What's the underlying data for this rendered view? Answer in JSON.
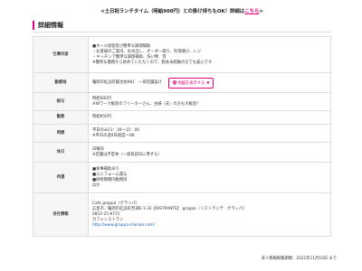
{
  "notice": {
    "prefix": "<土日祝ランチタイム（時給900円）との掛け持ちもOK！詳細は",
    "link": "こちら",
    "suffix": ">"
  },
  "section": {
    "title": "詳細情報"
  },
  "rows": {
    "job": {
      "label": "仕事内容",
      "lines": [
        "■ホール接客及び簡単な調理補助",
        "・お客様のご案内、お水出し、オーダー取り、料理運び、レジ",
        "・キッチンで簡単な調理補助、洗い物　等",
        "※簡単な業務から始めていただくので、飲食未経験の方でも安心です"
      ]
    },
    "location": {
      "label": "勤務地",
      "address": "亀岡市紅忌町鍛冶坊981　一部店舗設け",
      "map_button": "地図を表示する"
    },
    "wage": {
      "label": "給与",
      "lines": [
        "時給900円",
        "※Wワーク歓迎のフリーターさん、主婦（夫）の方も大歓迎！"
      ]
    },
    "transport": {
      "label": "勤務",
      "lines": [
        "時給850円"
      ]
    },
    "hours": {
      "label": "時間",
      "lines": [
        "平日のみ11：30〜15：00",
        "※平日の週4日程度〜OK"
      ]
    },
    "holiday": {
      "label": "休日",
      "lines": [
        "日曜日",
        "※店舗は不定休（一部祝前日に準ずる）"
      ]
    },
    "benefits": {
      "label": "待遇",
      "lines": [
        "■食事補助あり",
        "■ユニフォーム貸与",
        "■研修期間内勤務同",
        "ほか"
      ]
    },
    "company": {
      "label": "会社情報",
      "lines": [
        "Cafe grappa（グラッパ）",
        "広島市／亀岡市紅忌町西浦6-1-32【RISTRANTE】 grappa（リストランテ　グラッパ）",
        "0852-25-9715",
        "カフェレストラン",
        "http://www.grappa-maisae.com/"
      ]
    }
  },
  "footer": {
    "text": "求人情報掲載期間：2021年11月10日 まで"
  },
  "colors": {
    "accent": "#e6007e",
    "header_bg": "#f6f6f6",
    "border": "#dddddd",
    "link": "#1a5fb4"
  },
  "icons": {
    "map_pin": "map-pin-icon",
    "dropdown": "chevron-down-icon"
  }
}
